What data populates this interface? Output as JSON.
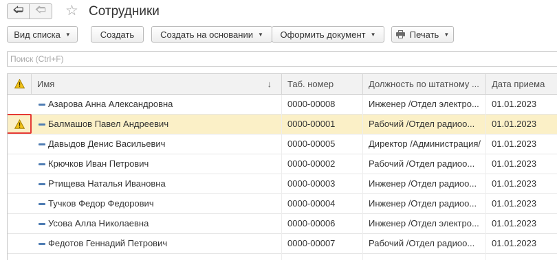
{
  "window": {
    "title": "Сотрудники",
    "back_icon": "arrow-left-icon",
    "forward_icon": "arrow-right-icon",
    "favorite_icon": "star-icon"
  },
  "toolbar": {
    "view_list_label": "Вид списка",
    "create_label": "Создать",
    "create_based_label": "Создать на основании",
    "make_document_label": "Оформить документ",
    "print_label": "Печать"
  },
  "search": {
    "placeholder": "Поиск (Ctrl+F)",
    "value": ""
  },
  "table": {
    "columns": {
      "status_icon": "warning-icon",
      "name": "Имя",
      "tab_number": "Таб. номер",
      "position": "Должность по штатному ...",
      "hire_date": "Дата приема"
    },
    "sort_indicator": "↓",
    "rows": [
      {
        "name": "Азарова Анна Александровна",
        "tab_number": "0000-00008",
        "position": "Инженер /Отдел электро...",
        "hire_date": "01.01.2023",
        "warning": false,
        "selected": false
      },
      {
        "name": "Балмашов Павел Андреевич",
        "tab_number": "0000-00001",
        "position": "Рабочий /Отдел радиоо...",
        "hire_date": "01.01.2023",
        "warning": true,
        "selected": true
      },
      {
        "name": "Давыдов Денис Васильевич",
        "tab_number": "0000-00005",
        "position": "Директор /Администрация/",
        "hire_date": "01.01.2023",
        "warning": false,
        "selected": false
      },
      {
        "name": "Крючков Иван Петрович",
        "tab_number": "0000-00002",
        "position": "Рабочий /Отдел радиоо...",
        "hire_date": "01.01.2023",
        "warning": false,
        "selected": false
      },
      {
        "name": "Ртищева Наталья Ивановна",
        "tab_number": "0000-00003",
        "position": "Инженер /Отдел радиоо...",
        "hire_date": "01.01.2023",
        "warning": false,
        "selected": false
      },
      {
        "name": "Тучков Федор Федорович",
        "tab_number": "0000-00004",
        "position": "Инженер /Отдел радиоо...",
        "hire_date": "01.01.2023",
        "warning": false,
        "selected": false
      },
      {
        "name": "Усова Алла Николаевна",
        "tab_number": "0000-00006",
        "position": "Инженер /Отдел электро...",
        "hire_date": "01.01.2023",
        "warning": false,
        "selected": false
      },
      {
        "name": "Федотов Геннадий Петрович",
        "tab_number": "0000-00007",
        "position": "Рабочий /Отдел радиоо...",
        "hire_date": "01.01.2023",
        "warning": false,
        "selected": false
      }
    ]
  },
  "colors": {
    "selected_row": "#fbf0c7",
    "warning_fill": "#f2c318",
    "highlight_border": "#e53935",
    "row_marker": "#4f7db3"
  }
}
